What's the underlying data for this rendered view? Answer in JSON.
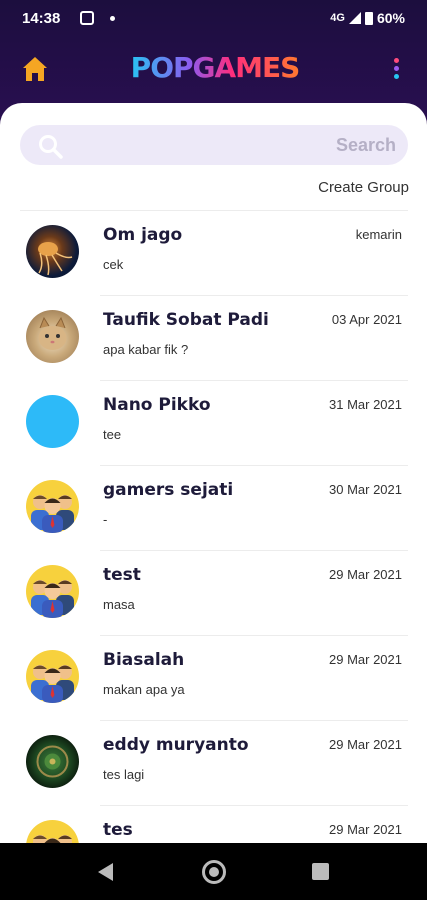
{
  "status_bar": {
    "time": "14:38",
    "network": "4G",
    "battery": "60%"
  },
  "header": {
    "logo_text": "POPGAMES"
  },
  "search": {
    "placeholder": "Search"
  },
  "create_group_label": "Create Group",
  "chats": [
    {
      "name": "Om jago",
      "preview": "cek",
      "date": "kemarin",
      "avatar": "jellyfish-photo"
    },
    {
      "name": "Taufik Sobat  Padi",
      "preview": "apa kabar fik ?",
      "date": "03 Apr 2021",
      "avatar": "cat-photo"
    },
    {
      "name": "Nano Pikko",
      "preview": "tee",
      "date": "31 Mar 2021",
      "avatar": "blue-circle"
    },
    {
      "name": "gamers sejati",
      "preview": "-",
      "date": "30 Mar 2021",
      "avatar": "group-people"
    },
    {
      "name": "test",
      "preview": "masa",
      "date": "29 Mar 2021",
      "avatar": "group-people"
    },
    {
      "name": "Biasalah",
      "preview": "makan apa ya",
      "date": "29 Mar 2021",
      "avatar": "group-people"
    },
    {
      "name": "eddy muryanto",
      "preview": "tes lagi",
      "date": "29 Mar 2021",
      "avatar": "green-emblem"
    },
    {
      "name": "tes",
      "preview": "",
      "date": "29 Mar 2021",
      "avatar": "group-people"
    }
  ],
  "colors": {
    "accent": "#f5a623",
    "header_bg": "#1c0e3e",
    "search_bg": "#ede9f8",
    "name_text": "#1e1b3a"
  }
}
